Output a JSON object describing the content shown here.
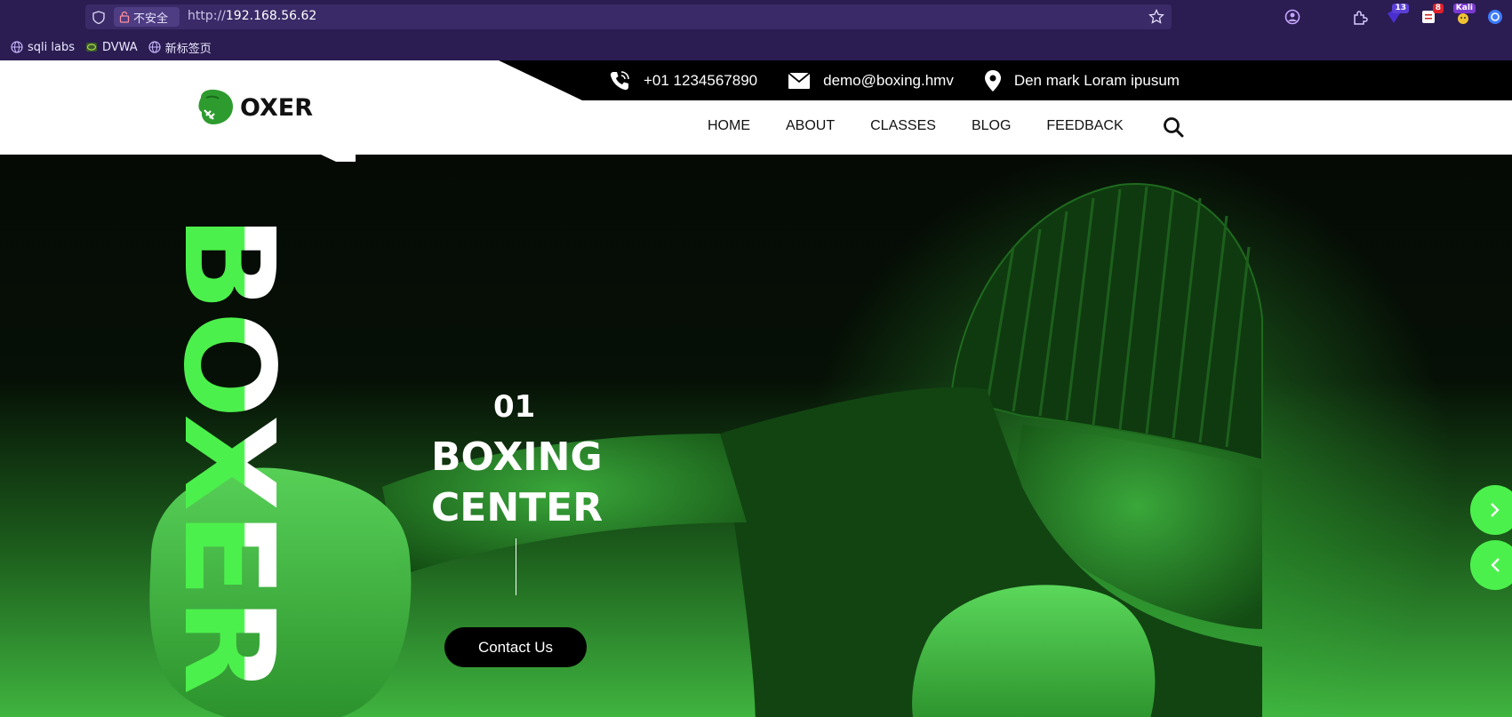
{
  "browser": {
    "insecure_label": "不安全",
    "url_scheme": "http://",
    "url_host": "192.168.56.62",
    "extensions": [
      {
        "name": "badge-13",
        "badge": "13"
      },
      {
        "name": "badge-8",
        "badge": "8"
      },
      {
        "name": "kali",
        "badge": "Kali"
      }
    ],
    "bookmarks": [
      {
        "label": "sqli labs"
      },
      {
        "label": "DVWA"
      },
      {
        "label": "新标签页"
      }
    ]
  },
  "site": {
    "logo_text": "OXER",
    "topbar": {
      "phone": "+01 1234567890",
      "email": "demo@boxing.hmv",
      "address": "Den mark Loram ipusum"
    },
    "nav": [
      "HOME",
      "ABOUT",
      "CLASSES",
      "BLOG",
      "FEEDBACK"
    ],
    "hero": {
      "vertical_word": "BOXER",
      "slide_number": "01",
      "title_line1": "BOXING",
      "title_line2": "CENTER",
      "button_label": "Contact Us"
    },
    "colors": {
      "accent_green": "#4cf04c",
      "browser_bg": "#2b1d52",
      "header_black": "#000000"
    }
  }
}
